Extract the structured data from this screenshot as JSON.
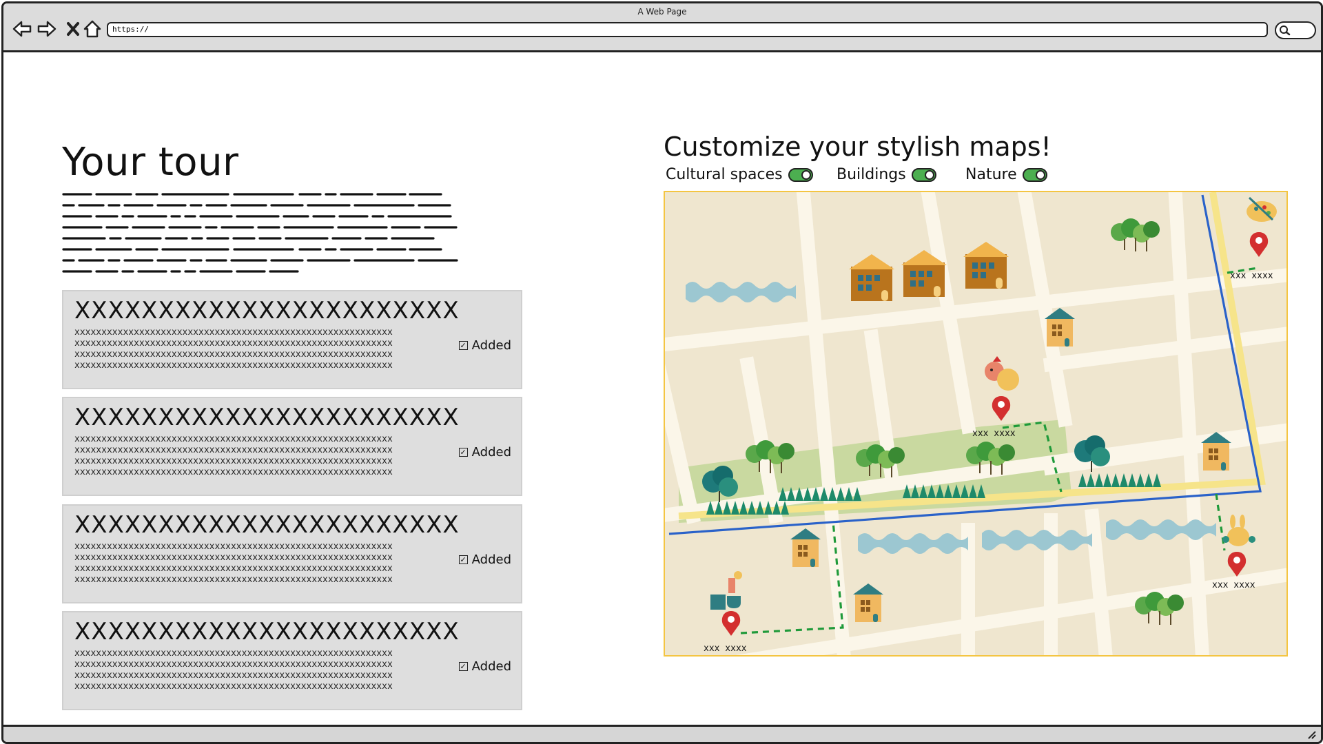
{
  "browser": {
    "title": "A Web Page",
    "url": "https://"
  },
  "tour": {
    "title": "Your tour",
    "cards": [
      {
        "title": "XXXXXXXXXXXXXXXXXXXXXXX",
        "body": [
          "xxxxxxxxxxxxxxxxxxxxxxxxxxxxxxxxxxxxxxxxxxxxxxxxxxxxxxxxxxx",
          "xxxxxxxxxxxxxxxxxxxxxxxxxxxxxxxxxxxxxxxxxxxxxxxxxxxxxxxxxxx",
          "xxxxxxxxxxxxxxxxxxxxxxxxxxxxxxxxxxxxxxxxxxxxxxxxxxxxxxxxxxx",
          "xxxxxxxxxxxxxxxxxxxxxxxxxxxxxxxxxxxxxxxxxxxxxxxxxxxxxxxxxxx"
        ],
        "status": "Added"
      },
      {
        "title": "XXXXXXXXXXXXXXXXXXXXXXX",
        "body": [
          "xxxxxxxxxxxxxxxxxxxxxxxxxxxxxxxxxxxxxxxxxxxxxxxxxxxxxxxxxxx",
          "xxxxxxxxxxxxxxxxxxxxxxxxxxxxxxxxxxxxxxxxxxxxxxxxxxxxxxxxxxx",
          "xxxxxxxxxxxxxxxxxxxxxxxxxxxxxxxxxxxxxxxxxxxxxxxxxxxxxxxxxxx",
          "xxxxxxxxxxxxxxxxxxxxxxxxxxxxxxxxxxxxxxxxxxxxxxxxxxxxxxxxxxx"
        ],
        "status": "Added"
      },
      {
        "title": "XXXXXXXXXXXXXXXXXXXXXXX",
        "body": [
          "xxxxxxxxxxxxxxxxxxxxxxxxxxxxxxxxxxxxxxxxxxxxxxxxxxxxxxxxxxx",
          "xxxxxxxxxxxxxxxxxxxxxxxxxxxxxxxxxxxxxxxxxxxxxxxxxxxxxxxxxxx",
          "xxxxxxxxxxxxxxxxxxxxxxxxxxxxxxxxxxxxxxxxxxxxxxxxxxxxxxxxxxx",
          "xxxxxxxxxxxxxxxxxxxxxxxxxxxxxxxxxxxxxxxxxxxxxxxxxxxxxxxxxxx"
        ],
        "status": "Added"
      },
      {
        "title": "XXXXXXXXXXXXXXXXXXXXXXX",
        "body": [
          "xxxxxxxxxxxxxxxxxxxxxxxxxxxxxxxxxxxxxxxxxxxxxxxxxxxxxxxxxxx",
          "xxxxxxxxxxxxxxxxxxxxxxxxxxxxxxxxxxxxxxxxxxxxxxxxxxxxxxxxxxx",
          "xxxxxxxxxxxxxxxxxxxxxxxxxxxxxxxxxxxxxxxxxxxxxxxxxxxxxxxxxxx",
          "xxxxxxxxxxxxxxxxxxxxxxxxxxxxxxxxxxxxxxxxxxxxxxxxxxxxxxxxxxx"
        ],
        "status": "Added"
      }
    ]
  },
  "map_panel": {
    "title": "Customize your stylish maps!",
    "toggles": [
      {
        "label": "Cultural spaces",
        "on": true
      },
      {
        "label": "Buildings",
        "on": true
      },
      {
        "label": "Nature",
        "on": true
      }
    ],
    "pins": [
      {
        "label": "xxx xxxx",
        "icon": "palette-icon"
      },
      {
        "label": "xxx xxxx",
        "icon": "rooster-icon"
      },
      {
        "label": "xxx xxxx",
        "icon": "rabbit-icon"
      },
      {
        "label": "xxx xxxx",
        "icon": "coffee-icon"
      }
    ]
  },
  "colors": {
    "toggle_on": "#4caf50",
    "card_bg": "#dedede",
    "map_border": "#f4c542",
    "pin": "#d32f2f",
    "route_blue": "#2a62c9",
    "route_green": "#1f9a3a"
  }
}
